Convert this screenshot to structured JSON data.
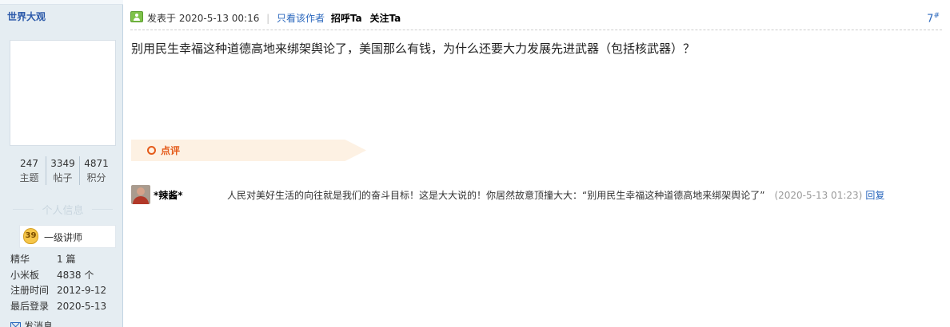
{
  "sidebar": {
    "username": "世界大观",
    "stats": [
      {
        "value": "247",
        "label": "主题"
      },
      {
        "value": "3349",
        "label": "帖子"
      },
      {
        "value": "4871",
        "label": "积分"
      }
    ],
    "section_title": "个人信息",
    "rank": {
      "badge": "39",
      "label": "一级讲师"
    },
    "info": [
      {
        "key": "精华",
        "value": "1 篇"
      },
      {
        "key": "小米板",
        "value": "4838 个"
      },
      {
        "key": "注册时间",
        "value": "2012-9-12"
      },
      {
        "key": "最后登录",
        "value": "2020-5-13"
      }
    ],
    "message_label": "发消息"
  },
  "post": {
    "posted_label": "发表于",
    "posted_time": "2020-5-13 00:16",
    "separator": "|",
    "only_author": "只看该作者",
    "greet": "招呼Ta",
    "follow": "关注Ta",
    "floor_number": "7",
    "floor_mark": "#",
    "content": "别用民生幸福这种道德高地来绑架舆论了，美国那么有钱，为什么还要大力发展先进武器（包括核武器）？"
  },
  "comments": {
    "label": "点评",
    "items": [
      {
        "user": "*辣酱*",
        "text": "人民对美好生活的向往就是我们的奋斗目标！这是大大说的！你居然故意顶撞大大：“别用民生幸福这种道德高地来绑架舆论了”",
        "time": "(2020-5-13 01:23)",
        "reply": "回复"
      }
    ]
  },
  "colors": {
    "link_blue": "#2a67bd",
    "sidebar_bg": "#e5edf2",
    "comment_orange": "#e45b1a",
    "comment_bg": "#fdf1e3"
  }
}
